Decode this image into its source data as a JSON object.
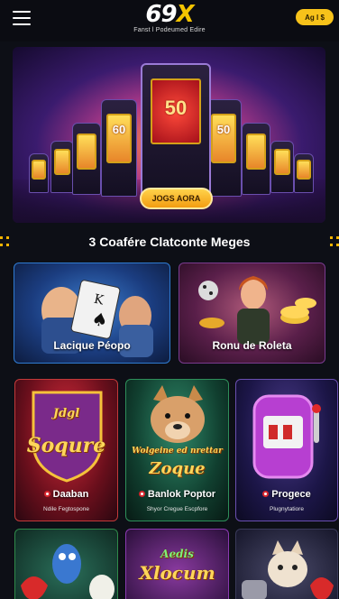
{
  "header": {
    "logo_main": "69",
    "logo_x": "X",
    "logo_sub": "Fanst l Podeumed Edire",
    "action_label": "Ag l $"
  },
  "hero": {
    "cta_label": "JOGS AORA",
    "slot_text": "50",
    "slot_text_small": "60"
  },
  "section": {
    "title": "3 Coafére Clatconte Meges"
  },
  "featured": [
    {
      "title": "Lacique Péopo",
      "icon": "poker-card-icon"
    },
    {
      "title": "Ronu de Roleta",
      "icon": "roulette-dealer-icon"
    }
  ],
  "games": [
    {
      "art": "Soqure",
      "art_top": "Jdgl",
      "title": "Daaban",
      "sub": "Ndile Fegtospone"
    },
    {
      "art": "Zoque",
      "art_top": "Wolgeine ed nrettar",
      "title": "Banlok Poptor",
      "sub": "Shyor Cregue Escpfore"
    },
    {
      "art": "",
      "art_top": "",
      "title": "Progece",
      "sub": "Plugnytatiore"
    }
  ],
  "bottom_row": [
    {
      "art": ""
    },
    {
      "art": "Xlocum",
      "art_top": "Aedis"
    },
    {
      "art": ""
    }
  ],
  "colors": {
    "accent": "#f7c21a",
    "background": "#0d0f16",
    "badge_red": "#d8262e"
  }
}
